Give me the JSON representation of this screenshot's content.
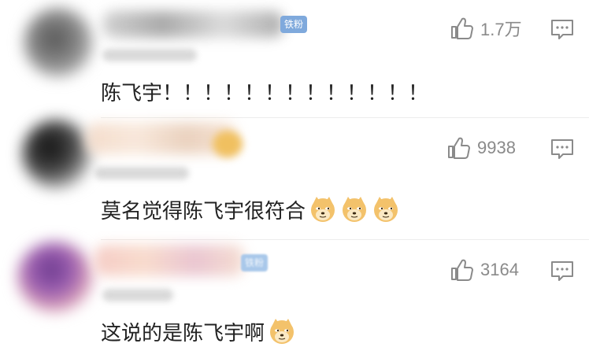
{
  "comments": [
    {
      "badge": "铁粉",
      "time_masked": "",
      "likes": "1.7万",
      "text": "陈飞宇！！！！！！！！！！！！！",
      "emojis": []
    },
    {
      "badge": "",
      "likes": "9938",
      "text": "莫名觉得陈飞宇很符合",
      "emojis": [
        "doge-emoji",
        "doge-emoji",
        "doge-emoji"
      ]
    },
    {
      "badge": "铁粉",
      "likes": "3164",
      "text": "这说的是陈飞宇啊",
      "emojis": [
        "doge-emoji"
      ]
    }
  ],
  "icons": {
    "like": "thumbs-up-icon",
    "reply": "comment-reply-icon"
  },
  "colors": {
    "badge": "#7fa9dc",
    "count": "#8a8a8a",
    "text": "#222222"
  }
}
